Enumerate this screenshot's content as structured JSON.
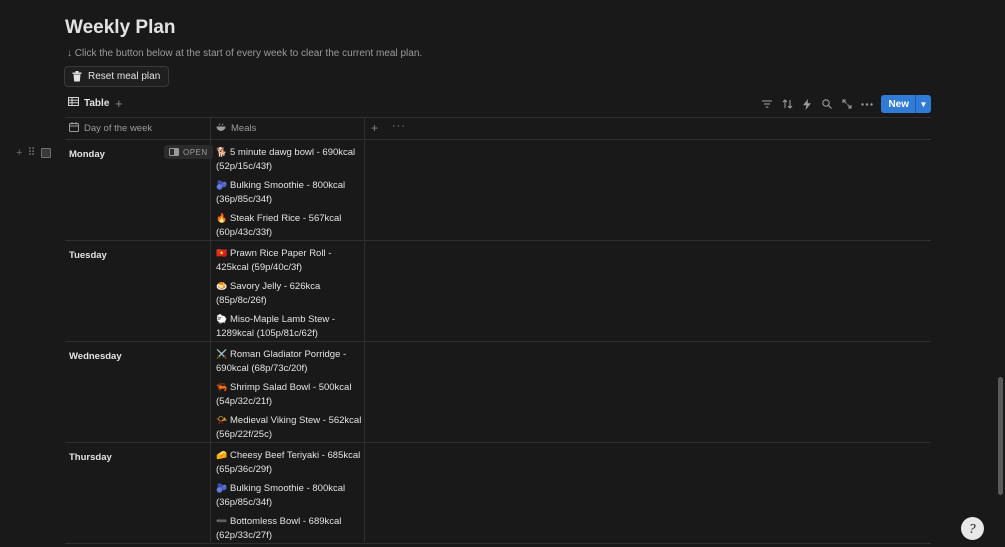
{
  "page": {
    "title": "Weekly Plan",
    "instruction": "↓ Click the button below at the start of every week to clear the current meal plan.",
    "reset_button": "Reset meal plan"
  },
  "view": {
    "tab_label": "Table",
    "add_view": "+",
    "new_button": "New"
  },
  "table": {
    "columns": [
      "Day of the week",
      "Meals"
    ],
    "open_badge": "OPEN",
    "rows": [
      {
        "day": "Monday",
        "meals": [
          {
            "emoji": "🐕",
            "text": "5 minute dawg bowl - 690kcal (52p/15c/43f)"
          },
          {
            "emoji": "🫐",
            "text": "Bulking Smoothie - 800kcal (36p/85c/34f)"
          },
          {
            "emoji": "🔥",
            "text": "Steak Fried Rice - 567kcal (60p/43c/33f)"
          }
        ]
      },
      {
        "day": "Tuesday",
        "meals": [
          {
            "emoji": "🇻🇳",
            "text": "Prawn Rice Paper Roll - 425kcal (59p/40c/3f)"
          },
          {
            "emoji": "🍮",
            "text": "Savory Jelly - 626kca (85p/8c/26f)"
          },
          {
            "emoji": "🐑",
            "text": "Miso-Maple Lamb Stew - 1289kcal (105p/81c/62f)"
          }
        ]
      },
      {
        "day": "Wednesday",
        "meals": [
          {
            "emoji": "⚔️",
            "text": "Roman Gladiator Porridge - 690kcal (68p/73c/20f)"
          },
          {
            "emoji": "🦐",
            "text": "Shrimp Salad Bowl - 500kcal (54p/32c/21f)"
          },
          {
            "emoji": "📯",
            "text": "Medieval Viking Stew - 562kcal (56p/22f/25c)"
          }
        ]
      },
      {
        "day": "Thursday",
        "meals": [
          {
            "emoji": "🧀",
            "text": "Cheesy Beef Teriyaki - 685kcal (65p/36c/29f)"
          },
          {
            "emoji": "🫐",
            "text": "Bulking Smoothie - 800kcal (36p/85c/34f)"
          },
          {
            "emoji": "➖",
            "text": "Bottomless Bowl - 689kcal (62p/33c/27f)"
          }
        ]
      }
    ]
  },
  "help_button": "?",
  "colors": {
    "background": "#191919",
    "accent": "#2f7bd6",
    "text": "#e3e3e3",
    "muted": "#9b9b9b",
    "border": "#2f2f2f"
  }
}
